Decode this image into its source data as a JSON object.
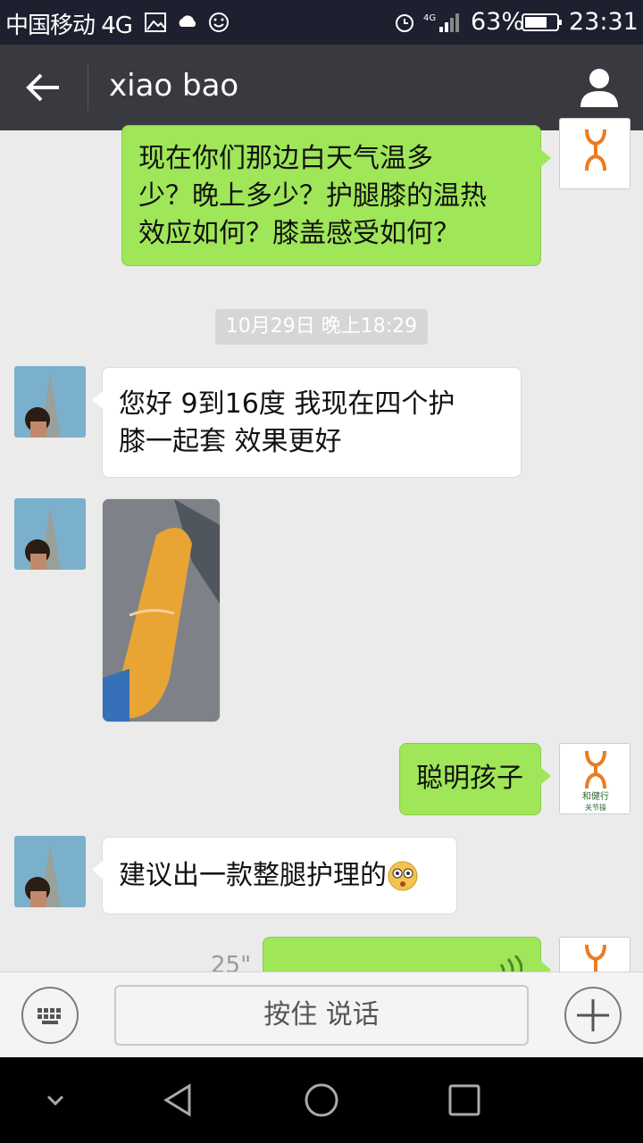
{
  "status_bar": {
    "carrier": "中国移动 4G",
    "battery_percent": "63%",
    "time": "23:31"
  },
  "header": {
    "title": "xiao bao"
  },
  "messages": [
    {
      "side": "out",
      "type": "text",
      "text": "现在你们那边白天气温多\n少？晚上多少？护腿膝的温热\n效应如何？膝盖感受如何？"
    },
    {
      "side": "in",
      "type": "text",
      "text": "您好 9到16度   我现在四个护\n膝一起套  效果更好"
    },
    {
      "side": "in",
      "type": "image",
      "description": "photo"
    },
    {
      "side": "out",
      "type": "text",
      "text": "聪明孩子"
    },
    {
      "side": "in",
      "type": "text",
      "text": "建议出一款整腿护理的"
    },
    {
      "side": "out",
      "type": "voice",
      "duration": "25\""
    }
  ],
  "timestamp": "10月29日 晚上18:29",
  "self_avatar": {
    "brand": "和健行",
    "tag": "关节操"
  },
  "input_bar": {
    "hold_to_talk_label": "按住 说话"
  },
  "colors": {
    "out_bubble": "#9fe658",
    "title_bar": "#393a3f",
    "status_bar": "#1e2030",
    "logo_orange": "#ea7d21"
  }
}
